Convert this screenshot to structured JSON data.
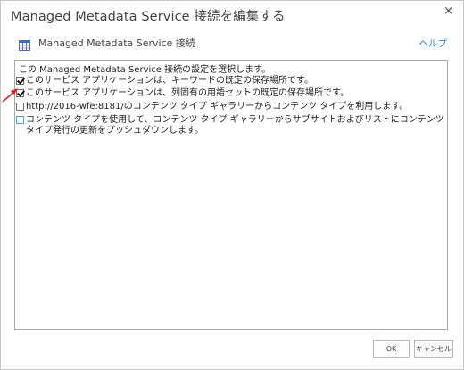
{
  "dialog": {
    "title": "Managed Metadata Service 接続を編集する",
    "close_icon": "×"
  },
  "subheader": {
    "icon": "metadata-service-icon",
    "text": "Managed Metadata Service 接続",
    "help_label": "ヘルプ"
  },
  "panel": {
    "instruction": "この Managed Metadata Service 接続の設定を選択します。",
    "options": [
      {
        "label": "このサービス アプリケーションは、キーワードの既定の保存場所です。",
        "checked": true
      },
      {
        "label": "このサービス アプリケーションは、列固有の用語セットの既定の保存場所です。",
        "checked": true
      },
      {
        "label": "http://2016-wfe:8181/のコンテンツ タイプ ギャラリーからコンテンツ タイプを利用します。",
        "checked": false
      },
      {
        "label": "コンテンツ タイプを使用して、コンテンツ タイプ ギャラリーからサブサイトおよびリストにコンテンツ タイプ発行の更新をプッシュダウンします。",
        "checked": false
      }
    ]
  },
  "buttons": {
    "ok_label": "OK",
    "cancel_label": "キャンセル"
  },
  "colors": {
    "link": "#2a7bd3",
    "arrow": "#e02020",
    "checkbox_blue": "#5b9bd5"
  }
}
